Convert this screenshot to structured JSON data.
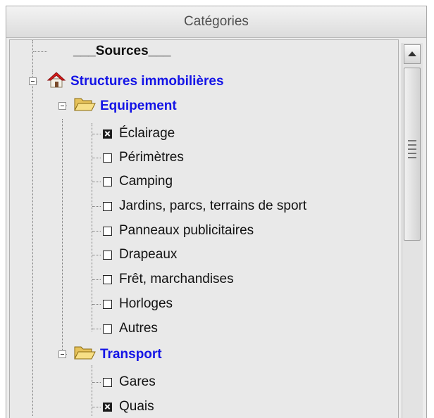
{
  "panel": {
    "title": "Catégories"
  },
  "tree": {
    "sources_label": "___Sources___",
    "root": {
      "label": "Structures immobilières",
      "icon": "house-icon"
    },
    "groups": [
      {
        "label": "Equipement",
        "icon": "open-folder-icon",
        "items": [
          {
            "label": "Éclairage",
            "checked": true
          },
          {
            "label": "Périmètres",
            "checked": false
          },
          {
            "label": "Camping",
            "checked": false
          },
          {
            "label": "Jardins, parcs, terrains de sport",
            "checked": false
          },
          {
            "label": "Panneaux publicitaires",
            "checked": false
          },
          {
            "label": "Drapeaux",
            "checked": false
          },
          {
            "label": "Frêt, marchandises",
            "checked": false
          },
          {
            "label": "Horloges",
            "checked": false
          },
          {
            "label": "Autres",
            "checked": false
          }
        ]
      },
      {
        "label": "Transport",
        "icon": "open-folder-icon",
        "items": [
          {
            "label": "Gares",
            "checked": false
          },
          {
            "label": "Quais",
            "checked": true
          }
        ]
      }
    ]
  },
  "colors": {
    "group_label": "#1414e6",
    "panel_bg": "#e9e9e9"
  }
}
